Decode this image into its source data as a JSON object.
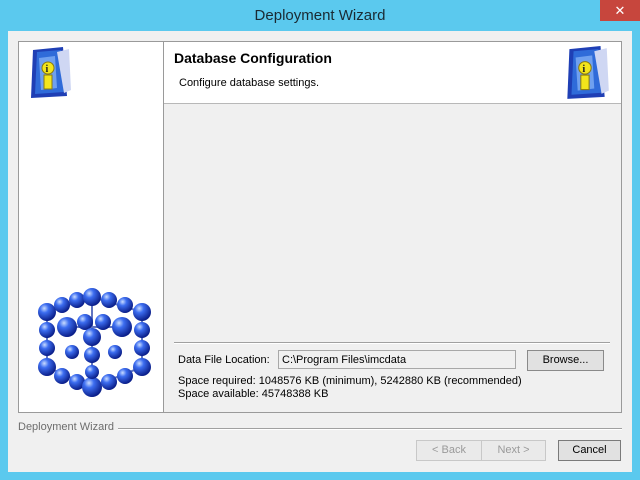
{
  "window": {
    "title": "Deployment Wizard",
    "close_glyph": "✕",
    "accent_color": "#5bc9ee",
    "close_color": "#c7463d"
  },
  "header": {
    "title": "Database Configuration",
    "subtitle": "Configure database settings."
  },
  "icons": {
    "info": "info-icon",
    "molecule": "molecule-graphic"
  },
  "data_file": {
    "label": "Data File Location:",
    "value": "C:\\Program Files\\imcdata",
    "browse_label": "Browse..."
  },
  "space": {
    "required": "Space required: 1048576 KB (minimum), 5242880 KB (recommended)",
    "available": "Space available: 45748388 KB"
  },
  "footer": {
    "label": "Deployment Wizard",
    "back_label": "< Back",
    "next_label": "Next >",
    "cancel_label": "Cancel"
  }
}
